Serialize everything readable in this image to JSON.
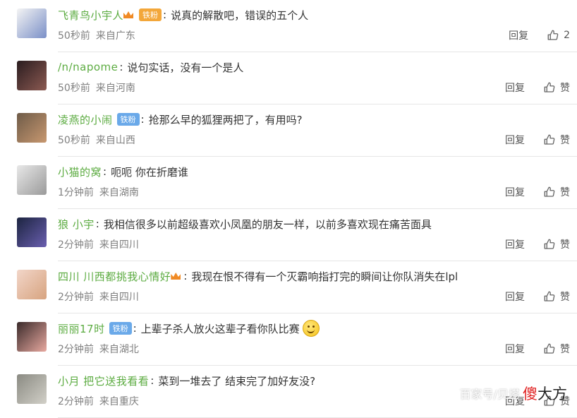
{
  "comments": [
    {
      "username": "飞青鸟小宇人",
      "badge": "铁粉",
      "badge_color": "orange",
      "crown": true,
      "text": "说真的解散吧，错误的五个人",
      "emoji": false,
      "time": "50秒前",
      "location": "来自广东",
      "reply": "回复",
      "likes": "2",
      "avatar_colors": [
        "#f4f4f4",
        "#7a8fc7"
      ]
    },
    {
      "username": "/n/napome",
      "badge": "",
      "badge_color": "",
      "crown": false,
      "text": "说句实话，没有一个是人",
      "emoji": false,
      "time": "50秒前",
      "location": "来自河南",
      "reply": "回复",
      "likes": "赞",
      "avatar_colors": [
        "#2a1c1f",
        "#8c5a52"
      ]
    },
    {
      "username": "凌燕的小闹",
      "badge": "铁粉",
      "badge_color": "blue",
      "crown": false,
      "text": "抢那么早的狐狸两把了，有用吗?",
      "emoji": false,
      "time": "50秒前",
      "location": "来自山西",
      "reply": "回复",
      "likes": "赞",
      "avatar_colors": [
        "#6e5b48",
        "#c89870"
      ]
    },
    {
      "username": "小猫的窝",
      "badge": "",
      "badge_color": "",
      "crown": false,
      "text": "呃呃 你在折磨谁",
      "emoji": false,
      "time": "1分钟前",
      "location": "来自湖南",
      "reply": "回复",
      "likes": "赞",
      "avatar_colors": [
        "#e8e8e8",
        "#9a9a9a"
      ]
    },
    {
      "username": "狼 小宇",
      "badge": "",
      "badge_color": "",
      "crown": false,
      "text": "我相信很多以前超级喜欢小凤凰的朋友一样，以前多喜欢现在痛苦面具",
      "emoji": false,
      "time": "2分钟前",
      "location": "来自四川",
      "reply": "回复",
      "likes": "赞",
      "avatar_colors": [
        "#1c2440",
        "#6a5fb0"
      ]
    },
    {
      "username": "四川 川西都挑我心情好",
      "badge": "",
      "badge_color": "",
      "crown": true,
      "text": "我现在恨不得有一个灭霸响指打完的瞬间让你队消失在lpl",
      "emoji": false,
      "time": "2分钟前",
      "location": "来自四川",
      "reply": "回复",
      "likes": "赞",
      "avatar_colors": [
        "#f2d6c9",
        "#d7a37f"
      ]
    },
    {
      "username": "丽丽17时",
      "badge": "铁粉",
      "badge_color": "blue",
      "crown": false,
      "text": "上辈子杀人放火这辈子看你队比赛",
      "emoji": true,
      "time": "2分钟前",
      "location": "来自湖北",
      "reply": "回复",
      "likes": "赞",
      "avatar_colors": [
        "#3a2a2a",
        "#e8a9a0"
      ]
    },
    {
      "username": "小月 把它送我看看",
      "badge": "",
      "badge_color": "",
      "crown": false,
      "text": "菜到一堆去了 结束完了加好友没?",
      "emoji": false,
      "time": "2分钟前",
      "location": "来自重庆",
      "reply": "回复",
      "likes": "赞",
      "avatar_colors": [
        "#8a8a82",
        "#d2d0c8"
      ]
    }
  ],
  "watermark": {
    "source": "百家号/贝塔",
    "brand_red": "傻",
    "brand_rest": "大方"
  },
  "colors": {
    "username": "#3f9d1f",
    "meta": "#808080",
    "divider": "#e6e6e6"
  }
}
